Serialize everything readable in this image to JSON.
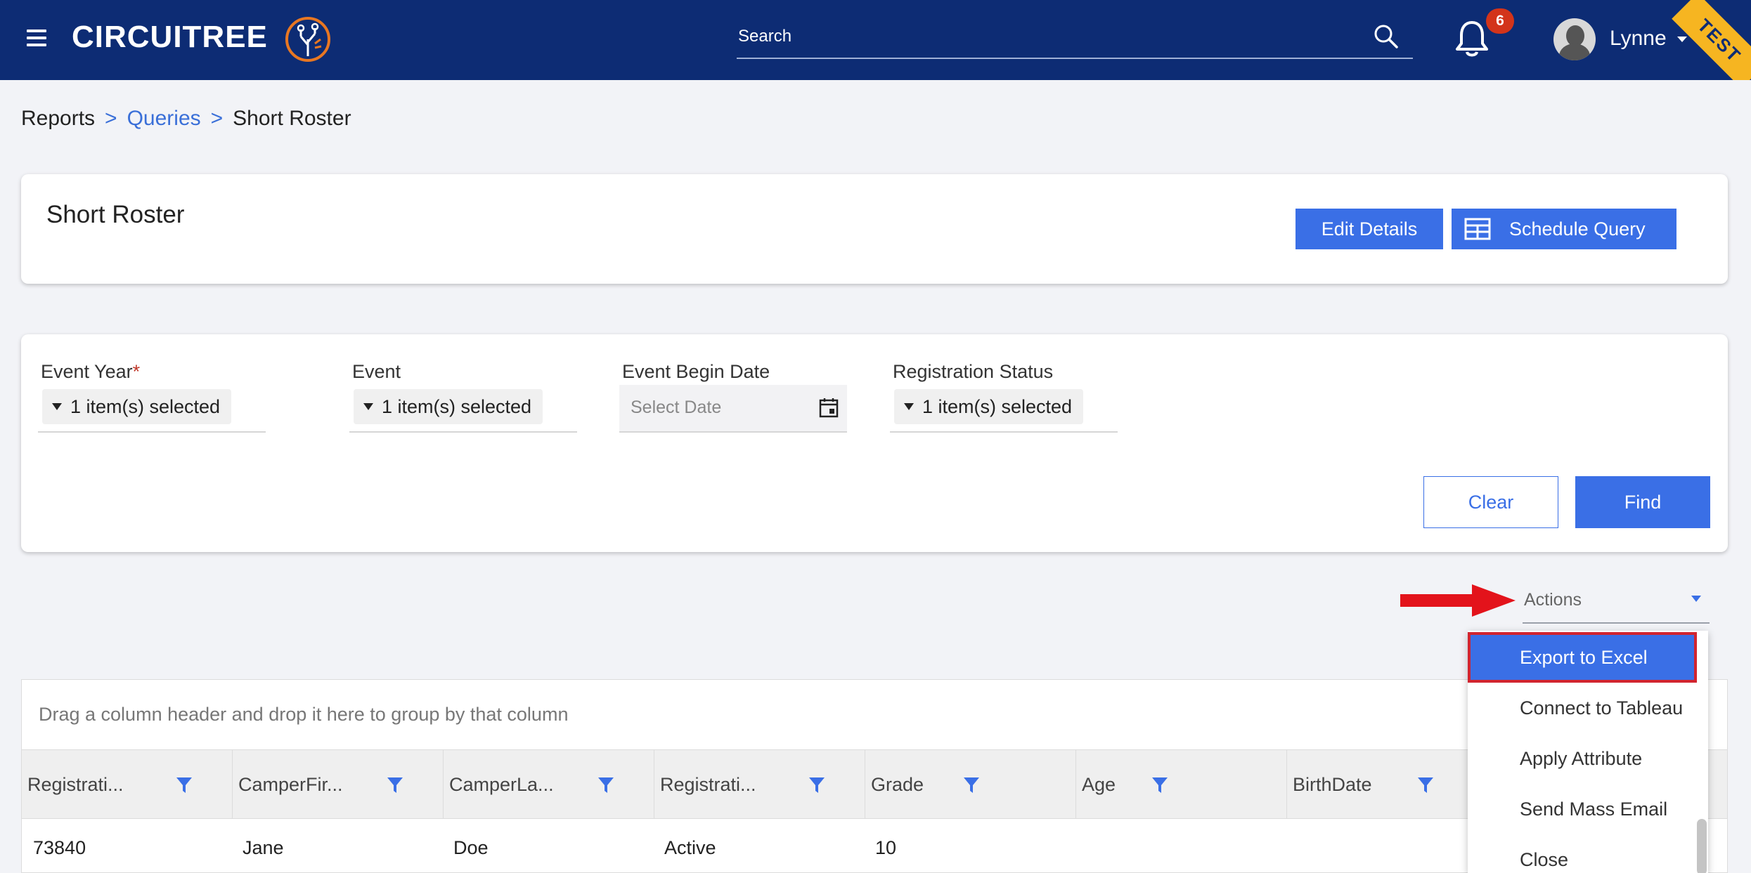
{
  "header": {
    "brand": "CIRCUITREE",
    "search_placeholder": "Search",
    "notification_count": "6",
    "user_name": "Lynne",
    "env_ribbon": "TEST",
    "icons": [
      "menu-icon",
      "search-icon",
      "bell-icon",
      "avatar",
      "chevron-down-icon"
    ],
    "colors": {
      "header_bg": "#0d2c74",
      "accent": "#3a6fe6",
      "badge": "#d3341a",
      "ribbon": "#f6b521"
    }
  },
  "breadcrumb": {
    "root": "Reports",
    "sep1": ">",
    "queries": "Queries",
    "sep2": ">",
    "current": "Short Roster"
  },
  "title_card": {
    "title": "Short Roster",
    "edit_details": "Edit Details",
    "schedule_query": "Schedule Query"
  },
  "filters": {
    "event_year": {
      "label": "Event Year",
      "required_mark": "*",
      "value": "1 item(s) selected"
    },
    "event": {
      "label": "Event",
      "value": "1 item(s) selected"
    },
    "event_begin_date": {
      "label": "Event Begin Date",
      "placeholder": "Select Date"
    },
    "registration_status": {
      "label": "Registration Status",
      "value": "1 item(s) selected"
    },
    "clear": "Clear",
    "find": "Find"
  },
  "actions": {
    "label": "Actions",
    "menu": [
      {
        "label": "Export to Excel",
        "highlighted": true
      },
      {
        "label": "Connect to Tableau"
      },
      {
        "label": "Apply Attribute"
      },
      {
        "label": "Send Mass Email"
      },
      {
        "label": "Close"
      }
    ]
  },
  "grid": {
    "group_hint": "Drag a column header and drop it here to group by that column",
    "columns": [
      "Registrati...",
      "CamperFir...",
      "CamperLa...",
      "Registrati...",
      "Grade",
      "Age",
      "BirthDate"
    ],
    "rows": [
      [
        "73840",
        "Jane",
        "Doe",
        "Active",
        "10",
        "",
        ""
      ]
    ]
  }
}
